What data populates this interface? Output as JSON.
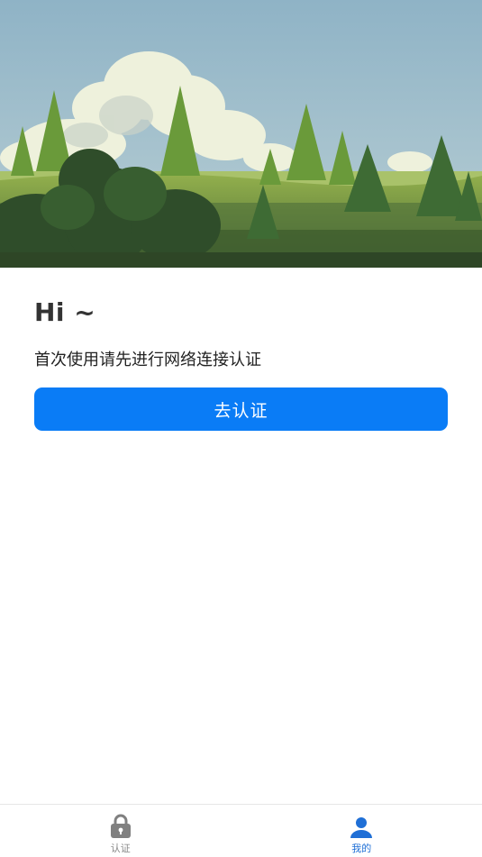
{
  "main": {
    "greeting": "Hi ~",
    "subtitle": "首次使用请先进行网络连接认证",
    "auth_button_label": "去认证"
  },
  "tabbar": {
    "items": [
      {
        "label": "认证",
        "icon": "lock-icon",
        "active": false
      },
      {
        "label": "我的",
        "icon": "user-icon",
        "active": true
      }
    ]
  },
  "colors": {
    "primary": "#0a7cf6",
    "tab_active": "#1f6fd6",
    "tab_inactive": "#888888",
    "text_dark": "#333333"
  }
}
